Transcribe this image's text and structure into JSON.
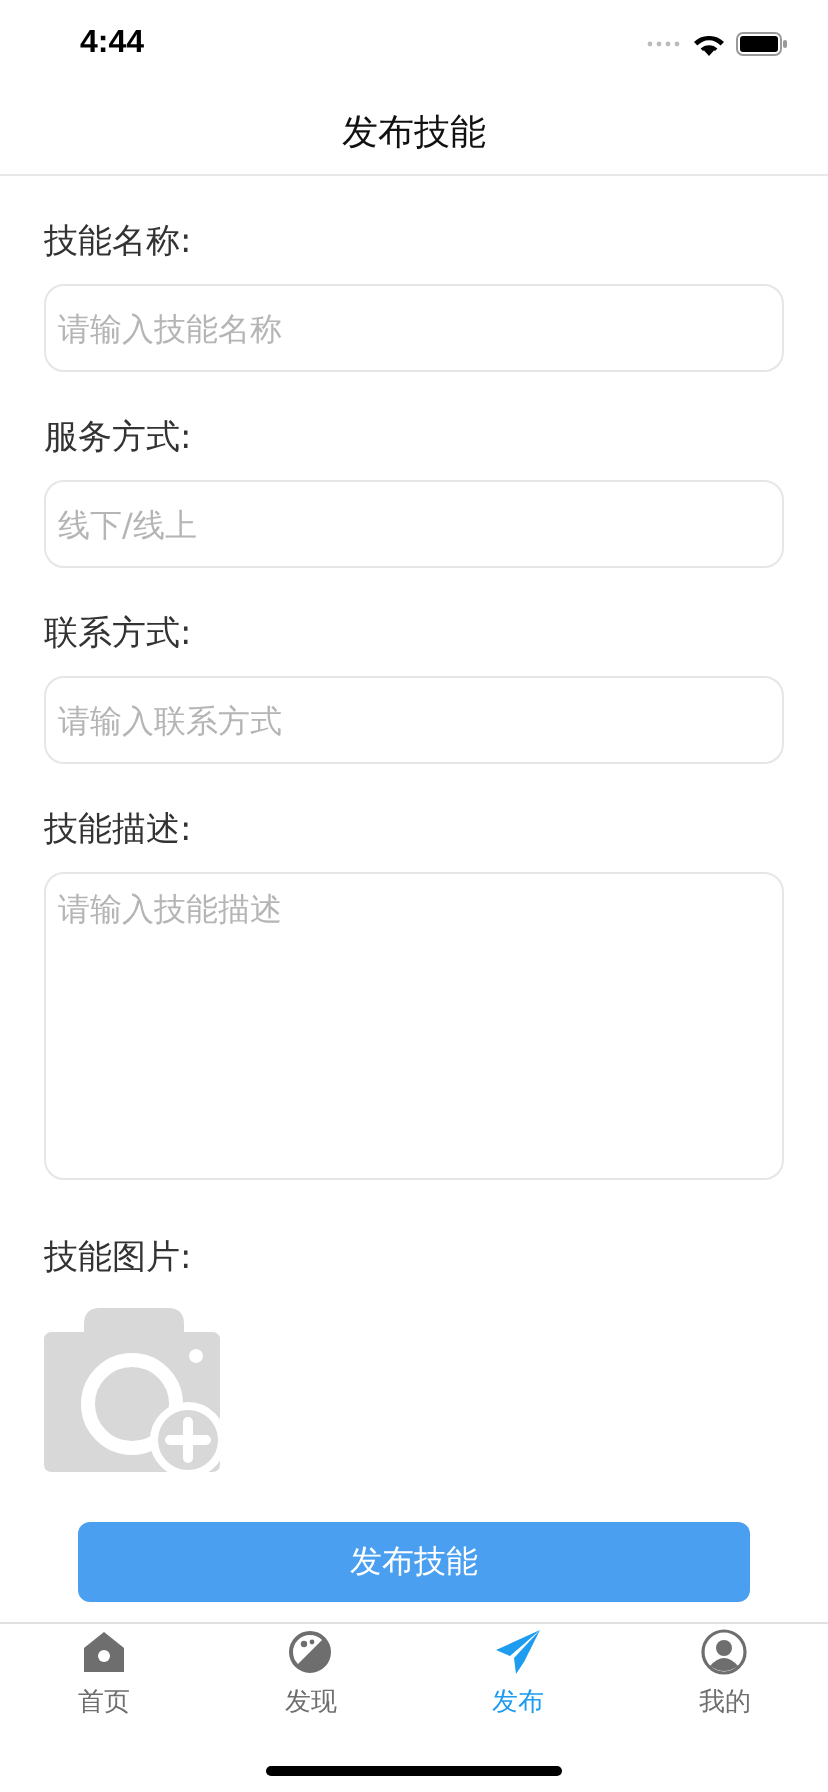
{
  "status_bar": {
    "time": "4:44"
  },
  "nav": {
    "title": "发布技能"
  },
  "fields": [
    {
      "kind": "input",
      "label": "技能名称:",
      "placeholder": "请输入技能名称"
    },
    {
      "kind": "input",
      "label": "服务方式:",
      "placeholder": "线下/线上"
    },
    {
      "kind": "input",
      "label": "联系方式:",
      "placeholder": "请输入联系方式"
    },
    {
      "kind": "textarea",
      "label": "技能描述:",
      "placeholder": "请输入技能描述"
    }
  ],
  "image_upload": {
    "label": "技能图片:"
  },
  "submit": {
    "label": "发布技能"
  },
  "tab_bar": [
    {
      "label": "首页",
      "kind": "home",
      "selected": false
    },
    {
      "label": "发现",
      "kind": "discover",
      "selected": false
    },
    {
      "label": "发布",
      "kind": "publish",
      "selected": true
    },
    {
      "label": "我的",
      "kind": "profile",
      "selected": false
    }
  ]
}
